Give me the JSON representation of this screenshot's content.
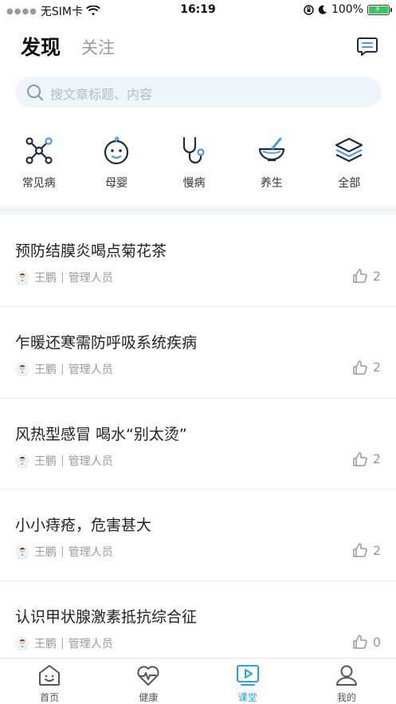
{
  "status_bar": {
    "carrier": "无SIM卡",
    "time": "16:19",
    "battery": "100%",
    "battery_level": 1.0
  },
  "header": {
    "tab_active": "发现",
    "tab_inactive": "关注",
    "chat_icon": "chat-bubble-icon"
  },
  "search": {
    "placeholder": "搜文章标题、内容",
    "icon": "search-icon"
  },
  "categories": [
    {
      "label": "常见病",
      "icon": "molecule-icon"
    },
    {
      "label": "母婴",
      "icon": "baby-face-icon"
    },
    {
      "label": "慢病",
      "icon": "stethoscope-icon"
    },
    {
      "label": "养生",
      "icon": "mortar-pestle-icon"
    },
    {
      "label": "全部",
      "icon": "layers-icon"
    }
  ],
  "articles": [
    {
      "title": "预防结膜炎喝点菊花茶",
      "author": "王鹏",
      "role": "管理人员",
      "likes": "2"
    },
    {
      "title": "乍暖还寒需防呼吸系统疾病",
      "author": "王鹏",
      "role": "管理人员",
      "likes": "2"
    },
    {
      "title": "风热型感冒 喝水“别太烫”",
      "author": "王鹏",
      "role": "管理人员",
      "likes": "2"
    },
    {
      "title": "小小痔疮，危害甚大",
      "author": "王鹏",
      "role": "管理人员",
      "likes": "2"
    },
    {
      "title": "认识甲状腺激素抵抗综合征",
      "author": "王鹏",
      "role": "管理人员",
      "likes": "0"
    }
  ],
  "bottom_nav": [
    {
      "label": "首页",
      "icon": "home-smile-icon"
    },
    {
      "label": "健康",
      "icon": "heart-pulse-icon"
    },
    {
      "label": "课堂",
      "icon": "video-class-icon",
      "active": true
    },
    {
      "label": "我的",
      "icon": "user-icon"
    }
  ],
  "colors": {
    "accent": "#2aa3d8",
    "icon_dark": "#1f2a44",
    "icon_accent": "#4a9ce0",
    "battery_green": "#3ac35c"
  }
}
